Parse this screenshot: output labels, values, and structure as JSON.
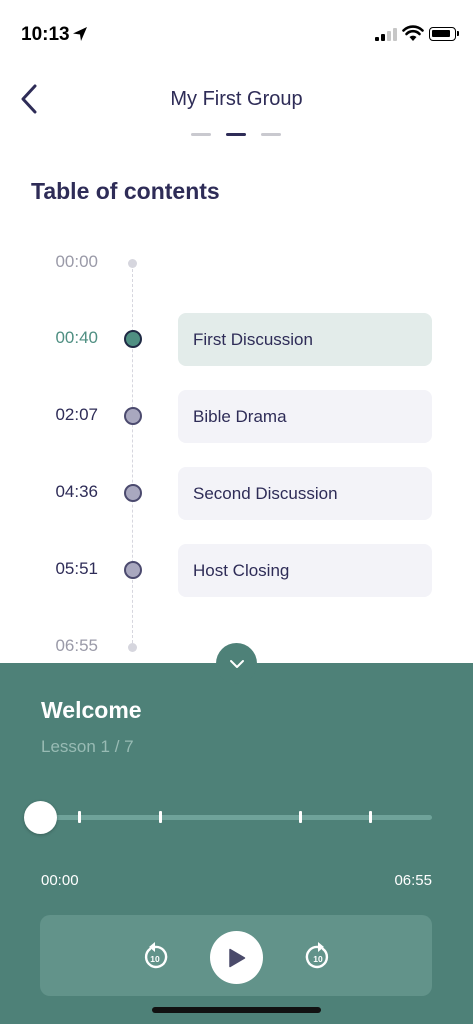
{
  "status": {
    "time": "10:13"
  },
  "header": {
    "title": "My First Group"
  },
  "toc": {
    "title": "Table of contents",
    "start_time": "00:00",
    "end_time": "06:55",
    "chapters": [
      {
        "time": "00:40",
        "label": "First Discussion"
      },
      {
        "time": "02:07",
        "label": "Bible Drama"
      },
      {
        "time": "04:36",
        "label": "Second Discussion"
      },
      {
        "time": "05:51",
        "label": "Host Closing"
      }
    ]
  },
  "player": {
    "title": "Welcome",
    "subtitle": "Lesson 1 / 7",
    "current_time": "00:00",
    "duration": "06:55",
    "progress": 0,
    "skip_seconds": "10"
  },
  "colors": {
    "accent": "#4e8178",
    "text": "#2e2c57",
    "current_chapter_bg": "#e3ecea"
  }
}
